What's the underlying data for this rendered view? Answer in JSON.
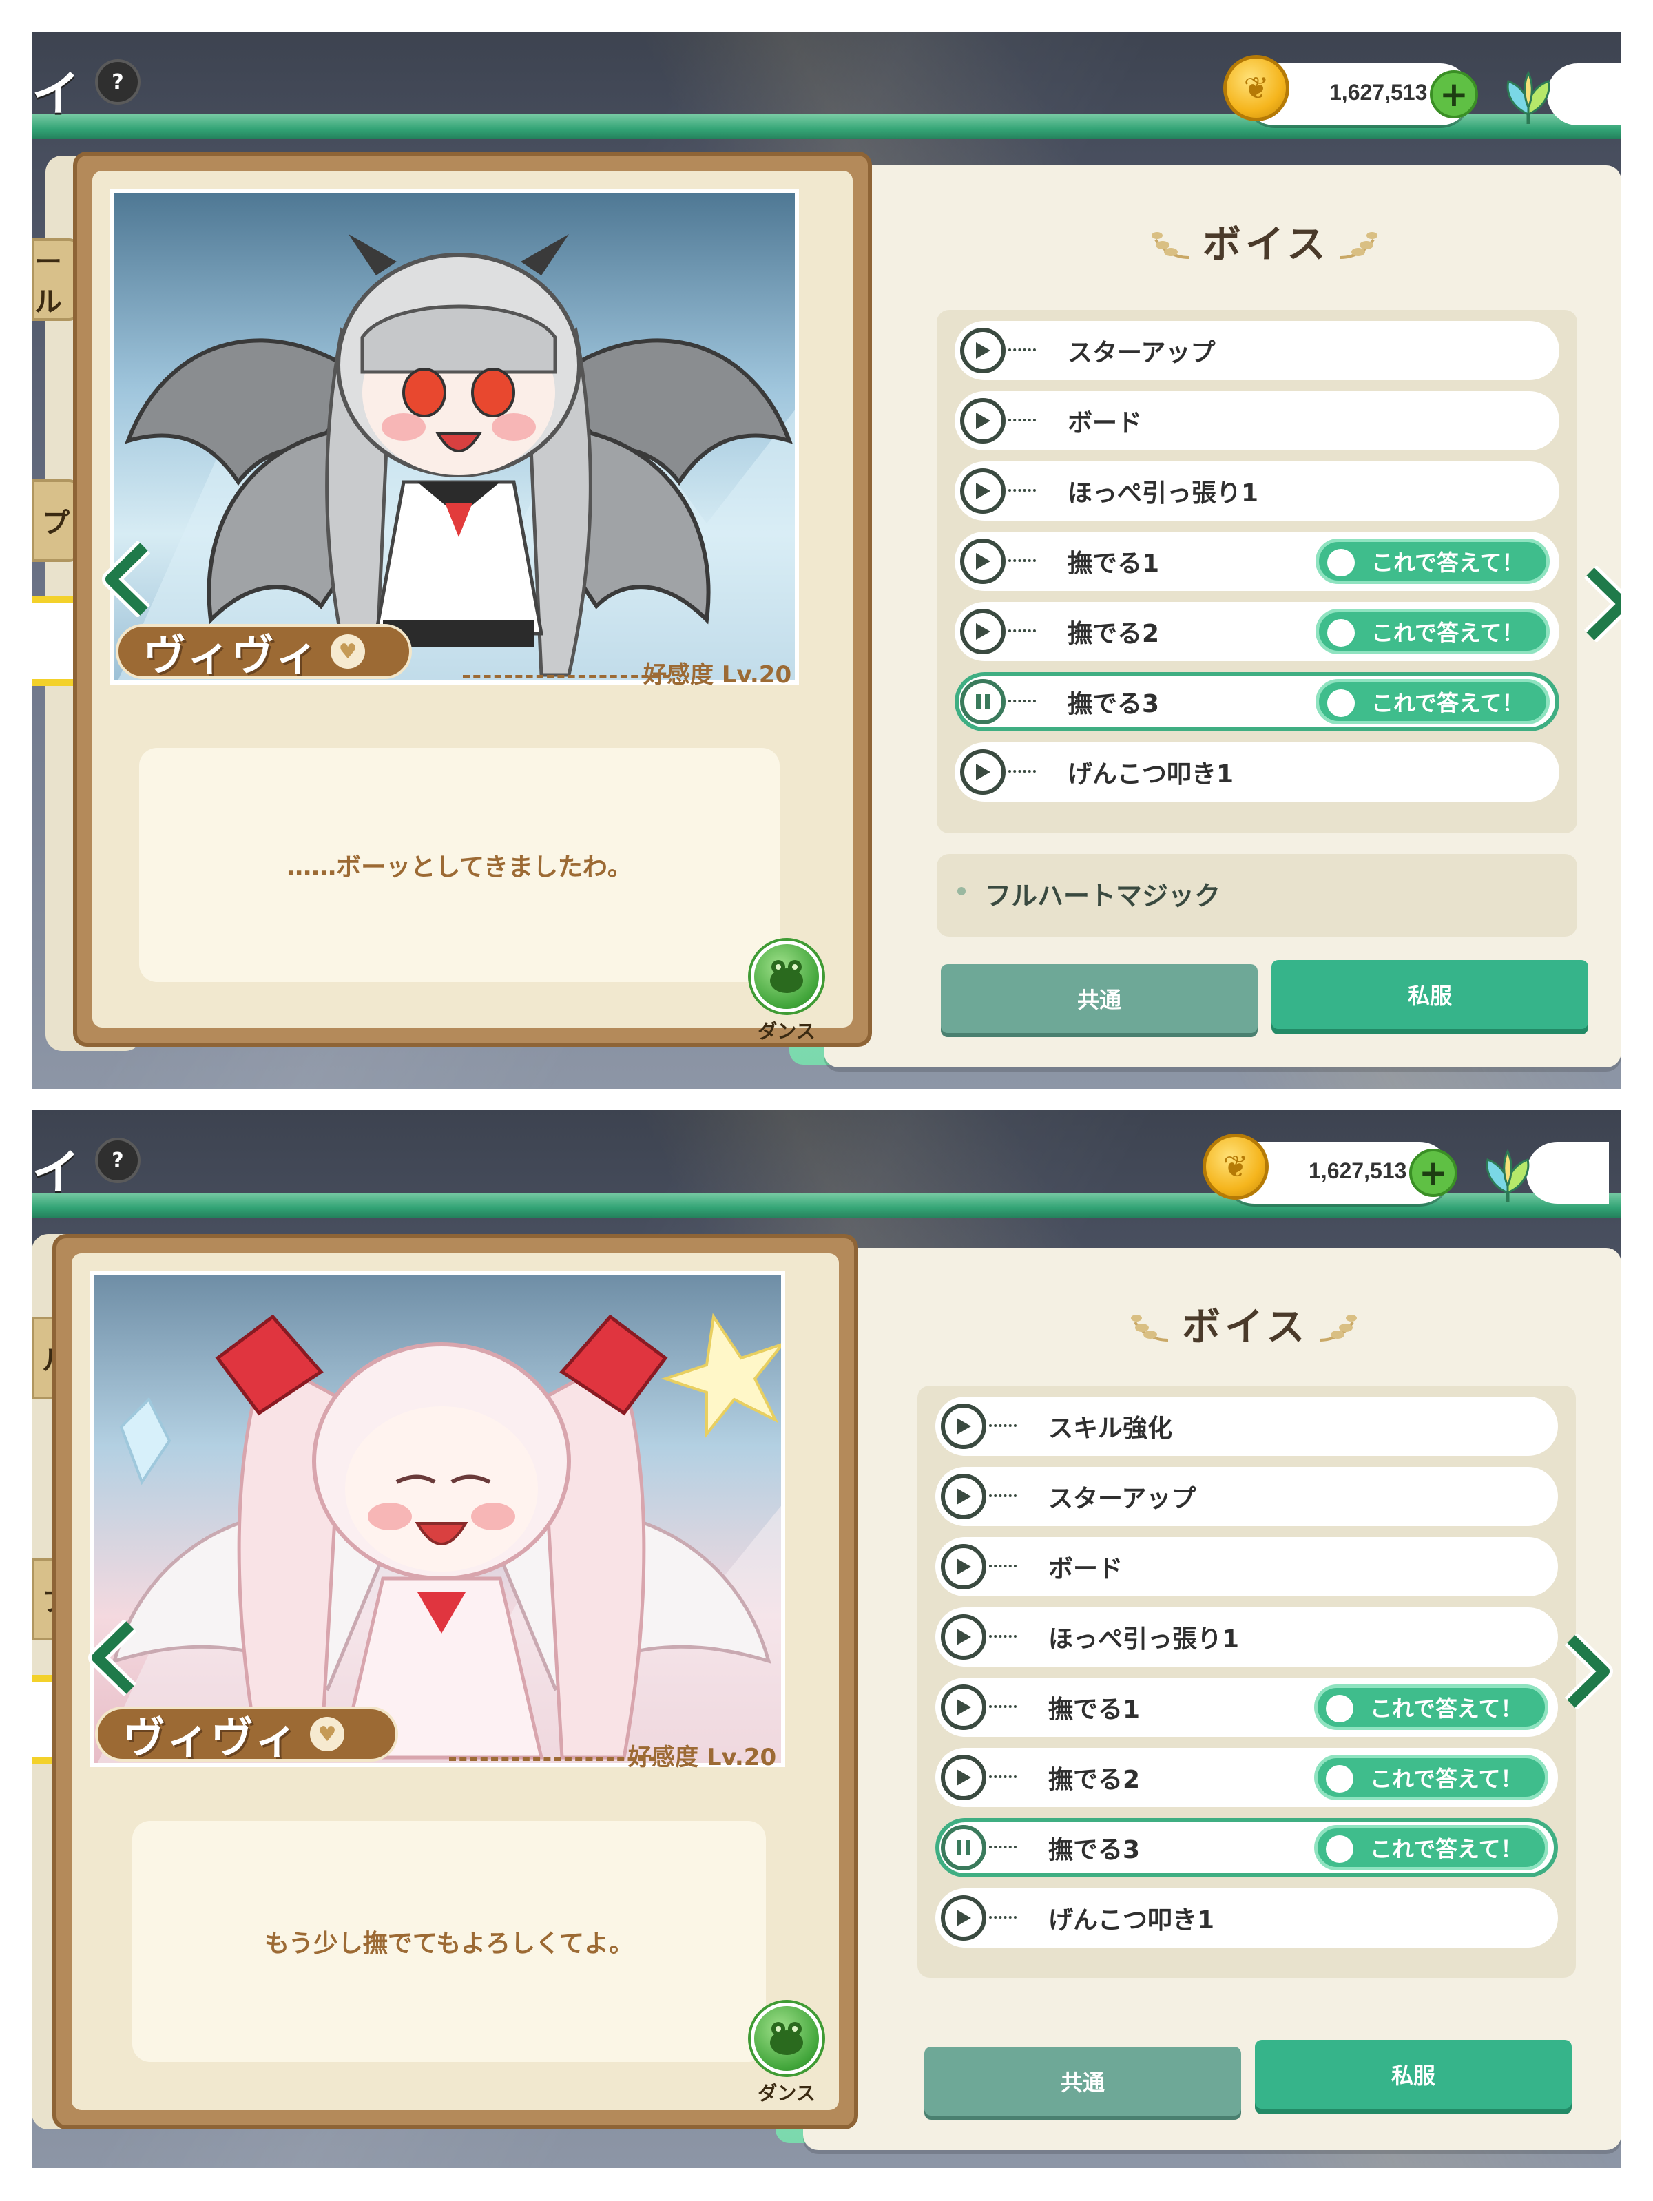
{
  "panels": [
    {
      "title_fragment": "イ",
      "help_label": "?",
      "currency": {
        "amount": "1,627,513",
        "plus_label": "+"
      },
      "side_tabs": [
        "ール",
        "プ"
      ],
      "character": {
        "name": "ヴィヴィ",
        "affinity": "好感度 Lv.20",
        "line": "……ボーッとしてきましたわ。",
        "dance_label": "ダンス",
        "outfit": "dark"
      },
      "voice": {
        "title": "ボイス",
        "items": [
          {
            "label": "スターアップ",
            "answer": false,
            "playing": false
          },
          {
            "label": "ボード",
            "answer": false,
            "playing": false
          },
          {
            "label": "ほっぺ引っ張り1",
            "answer": false,
            "playing": false
          },
          {
            "label": "撫でる1",
            "answer": true,
            "playing": false
          },
          {
            "label": "撫でる2",
            "answer": true,
            "playing": false
          },
          {
            "label": "撫でる3",
            "answer": true,
            "playing": true
          },
          {
            "label": "げんこつ叩き1",
            "answer": false,
            "playing": false
          }
        ],
        "answer_label": "これで答えて！",
        "section_title": "フルハートマジック"
      },
      "tabs": {
        "common": "共通",
        "private": "私服"
      }
    },
    {
      "title_fragment": "イ",
      "help_label": "?",
      "currency": {
        "amount": "1,627,513",
        "plus_label": "+"
      },
      "side_tabs": [
        "ル",
        "プ"
      ],
      "character": {
        "name": "ヴィヴィ",
        "affinity": "好感度 Lv.20",
        "line": "もう少し撫でてもよろしくてよ。",
        "dance_label": "ダンス",
        "outfit": "pink"
      },
      "voice": {
        "title": "ボイス",
        "items": [
          {
            "label": "スキル強化",
            "answer": false,
            "playing": false
          },
          {
            "label": "スターアップ",
            "answer": false,
            "playing": false
          },
          {
            "label": "ボード",
            "answer": false,
            "playing": false
          },
          {
            "label": "ほっぺ引っ張り1",
            "answer": false,
            "playing": false
          },
          {
            "label": "撫でる1",
            "answer": true,
            "playing": false
          },
          {
            "label": "撫でる2",
            "answer": true,
            "playing": false
          },
          {
            "label": "撫でる3",
            "answer": true,
            "playing": true
          },
          {
            "label": "げんこつ叩き1",
            "answer": false,
            "playing": false
          }
        ],
        "answer_label": "これで答えて！"
      },
      "tabs": {
        "common": "共通",
        "private": "私服"
      }
    }
  ],
  "colors": {
    "accent_green": "#36b48a",
    "card_brown": "#9c6a34",
    "coin_gold": "#f5b51d"
  }
}
